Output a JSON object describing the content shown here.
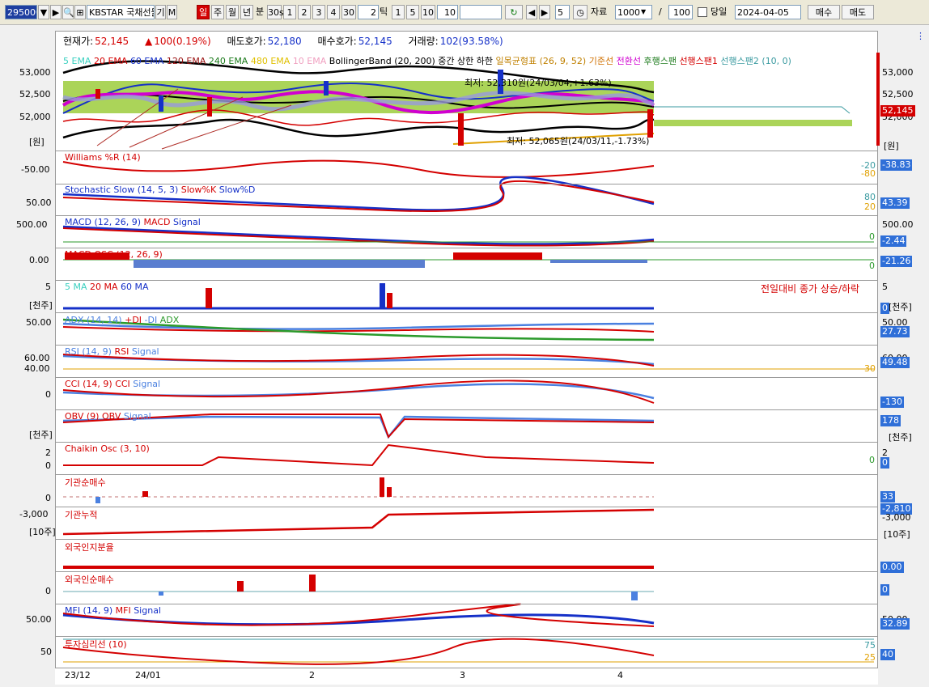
{
  "toolbar": {
    "code": "295000",
    "name": "KBSTAR 국채선물",
    "name_btns": [
      "기",
      "M"
    ],
    "periods": [
      "일",
      "주",
      "월",
      "년",
      "분"
    ],
    "minutes": [
      "30s",
      "1",
      "2",
      "3",
      "4",
      "30"
    ],
    "tick_value": "2",
    "tick_label": "틱",
    "nums": [
      "1",
      "5",
      "10"
    ],
    "num_value": "10",
    "count_value": "5",
    "data_label": "자료",
    "data_count": "1000",
    "slash": "/",
    "data_total": "100",
    "today_label": "당일",
    "date": "2024-04-05",
    "buy": "매수",
    "sell": "매도"
  },
  "info": {
    "price_label": "현재가:",
    "price": "52,145",
    "change": "100(0.19%)",
    "ask_label": "매도호가:",
    "ask": "52,180",
    "bid_label": "매수호가:",
    "bid": "52,145",
    "vol_label": "거래량:",
    "vol": "102(93.58%)"
  },
  "price_panel": {
    "legend": [
      "5 EMA",
      "20 EMA",
      "60 EMA",
      "120 EMA",
      "240 EMA",
      "480 EMA",
      "10 EMA",
      "BollingerBand (20, 200)",
      "중간",
      "상한",
      "하한",
      "일목균형표 (26, 9, 52)",
      "기준선",
      "전환선",
      "후행스팬",
      "선행스팬1",
      "선행스팬2 (10, 0)"
    ],
    "max_note": "최저: 52,310원(24/03/04,+1.63%)",
    "min_note": "최저: 52,065원(24/03/11,-1.73%)",
    "y_ticks": [
      "53,000",
      "52,500",
      "52,000"
    ],
    "unit": "[원]",
    "right_ticks": [
      "53,000",
      "52,500",
      "52,000"
    ],
    "current": "52,145"
  },
  "indicators": {
    "willr": {
      "name": "Williams %R (14)",
      "tick": "-50.00",
      "lv1": "-20",
      "lv2": "-80",
      "value": "-38.83"
    },
    "stoch": {
      "name": "Stochastic Slow (14, 5, 3)",
      "k": "Slow%K",
      "d": "Slow%D",
      "tick": "50.00",
      "lv1": "80",
      "lv2": "20",
      "value": "43.39"
    },
    "macd": {
      "name": "MACD (12, 26, 9)",
      "m": "MACD",
      "s": "Signal",
      "tick": "500.00",
      "lv": "0",
      "value": "-2.44",
      "rtick": "500.00"
    },
    "macdosc": {
      "name": "MACD OSC (12, 26, 9)",
      "tick": "0.00",
      "lv": "0",
      "value": "-21.26"
    },
    "volume": {
      "names": [
        "5 MA",
        "20 MA",
        "60 MA"
      ],
      "tick": "5",
      "unit": "[천주]",
      "note": "전일대비 종가 상승/하락",
      "rtick": "5",
      "value": "0",
      "runit": "[천주]"
    },
    "adx": {
      "name": "ADX (14, 14)",
      "p": "+DI",
      "m": "-DI",
      "a": "ADX",
      "tick": "50.00",
      "rtick": "50.00",
      "value": "27.73"
    },
    "rsi": {
      "name": "RSI (14, 9)",
      "r": "RSI",
      "s": "Signal",
      "tick1": "60.00",
      "tick2": "40.00",
      "rtick": "60.00",
      "lv": "30",
      "value": "49.48"
    },
    "cci": {
      "name": "CCI (14, 9)",
      "c": "CCI",
      "s": "Signal",
      "tick": "0",
      "value": "-130"
    },
    "obv": {
      "name": "OBV (9)",
      "o": "OBV",
      "s": "Signal",
      "unit": "[천주]",
      "value": "178",
      "runit": "[천주]"
    },
    "chaikin": {
      "name": "Chaikin Osc (3, 10)",
      "tick1": "2",
      "tick2": "0",
      "rtick": "2",
      "lv": "0",
      "value": "0"
    },
    "inst_net": {
      "name": "기관순매수",
      "tick": "0",
      "value": "33"
    },
    "inst_cum": {
      "name": "기관누적",
      "tick": "-3,000",
      "unit": "[10주]",
      "value": "-2,810",
      "rtick": "-3,000",
      "runit": "[10주]"
    },
    "foreign_ratio": {
      "name": "외국인지분율",
      "value": "0.00"
    },
    "foreign_net": {
      "name": "외국인순매수",
      "tick": "0",
      "value": "0"
    },
    "mfi": {
      "name": "MFI (14, 9)",
      "m": "MFI",
      "s": "Signal",
      "tick": "50.00",
      "rtick": "50.00",
      "value": "32.89"
    },
    "psy": {
      "name": "투자심리선 (10)",
      "tick": "50",
      "lv1": "75",
      "lv2": "25",
      "value": "40"
    }
  },
  "dates": [
    "23/12",
    "24/01",
    "2",
    "3",
    "4"
  ],
  "colors": {
    "up": "#d40000",
    "down": "#1530c8",
    "accent": "#2f6fd8"
  }
}
